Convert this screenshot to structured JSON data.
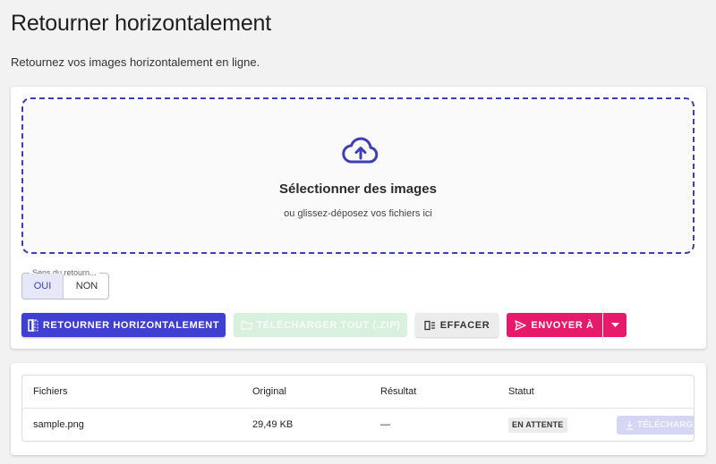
{
  "page": {
    "title": "Retourner horizontalement",
    "subtitle": "Retournez vos images horizontalement en ligne."
  },
  "dropzone": {
    "title": "Sélectionner des images",
    "subtitle": "ou glissez-déposez vos fichiers ici",
    "icon": "cloud-upload-icon"
  },
  "direction": {
    "legend": "Sens du retourn...",
    "options": [
      "OUI",
      "NON"
    ],
    "selected": "OUI"
  },
  "toolbar": {
    "flip_label": "RETOURNER HORIZONTALEMENT",
    "download_all_label": "TÉLÉCHARGER TOUT (.ZIP)",
    "clear_label": "EFFACER",
    "send_label": "ENVOYER À"
  },
  "colors": {
    "primary": "#3f3fd3",
    "dashed_border": "#3f3fb5",
    "send": "#e6196a",
    "download_disabled": "#d8f0de"
  },
  "table": {
    "headers": [
      "Fichiers",
      "Original",
      "Résultat",
      "Statut"
    ],
    "rows": [
      {
        "file": "sample.png",
        "original": "29,49 KB",
        "result": "—",
        "status": "EN ATTENTE",
        "action": "TÉLÉCHARGER"
      }
    ]
  }
}
